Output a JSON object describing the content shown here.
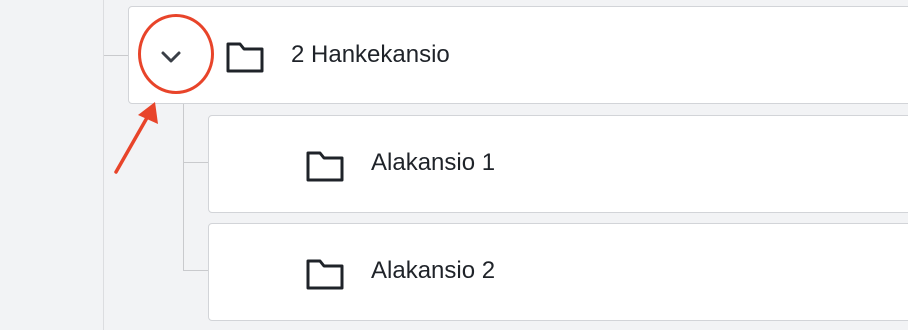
{
  "tree": {
    "parent": {
      "label": "2 Hankekansio",
      "expanded": true,
      "toggle_icon": "chevron-down-icon",
      "icon": "folder-icon"
    },
    "children": [
      {
        "label": "Alakansio 1",
        "icon": "folder-icon"
      },
      {
        "label": "Alakansio 2",
        "icon": "folder-icon"
      }
    ]
  },
  "annotation": {
    "type": "circle-with-arrow",
    "target": "expand-collapse-toggle",
    "color": "#e8442a"
  },
  "colors": {
    "background": "#f2f3f5",
    "row_background": "#ffffff",
    "row_border": "#d2d4d8",
    "text": "#1f2329",
    "icon": "#1f2329",
    "annotation": "#e8442a"
  }
}
